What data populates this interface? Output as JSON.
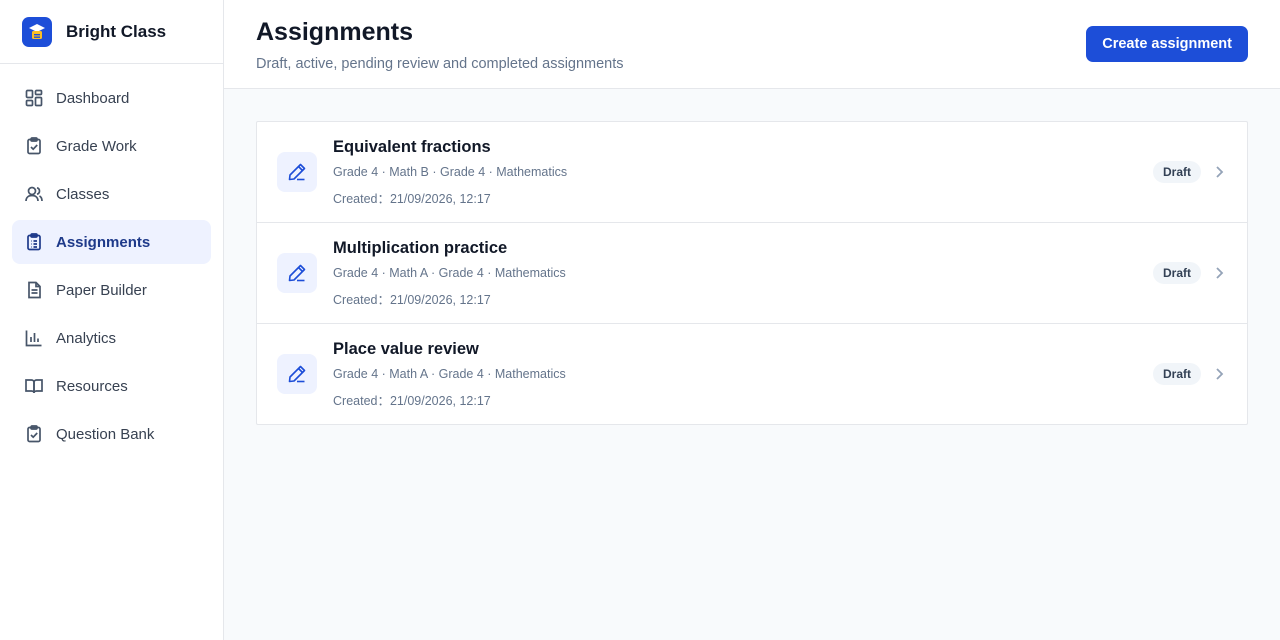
{
  "app": {
    "name": "Bright Class"
  },
  "sidebar": {
    "items": [
      {
        "label": "Dashboard",
        "icon": "dashboard-icon"
      },
      {
        "label": "Grade Work",
        "icon": "clipboard-check-icon"
      },
      {
        "label": "Classes",
        "icon": "users-icon"
      },
      {
        "label": "Assignments",
        "icon": "clipboard-list-icon",
        "active": true
      },
      {
        "label": "Paper Builder",
        "icon": "file-text-icon"
      },
      {
        "label": "Analytics",
        "icon": "bar-chart-icon"
      },
      {
        "label": "Resources",
        "icon": "book-open-icon"
      },
      {
        "label": "Question Bank",
        "icon": "clipboard-check-icon"
      }
    ]
  },
  "header": {
    "title": "Assignments",
    "subtitle": "Draft, active, pending review and completed assignments",
    "create_label": "Create assignment"
  },
  "assignments": [
    {
      "title": "Equivalent fractions",
      "meta": "Grade 4 · Math B · Grade 4 · Mathematics",
      "created": "Created：21/09/2026, 12:17",
      "status": "Draft"
    },
    {
      "title": "Multiplication practice",
      "meta": "Grade 4 · Math A · Grade 4 · Mathematics",
      "created": "Created：21/09/2026, 12:17",
      "status": "Draft"
    },
    {
      "title": "Place value review",
      "meta": "Grade 4 · Math A · Grade 4 · Mathematics",
      "created": "Created：21/09/2026, 12:17",
      "status": "Draft"
    }
  ],
  "colors": {
    "accent": "#1d4ed8",
    "active_bg": "#eef2ff",
    "muted_text": "#64748b"
  }
}
